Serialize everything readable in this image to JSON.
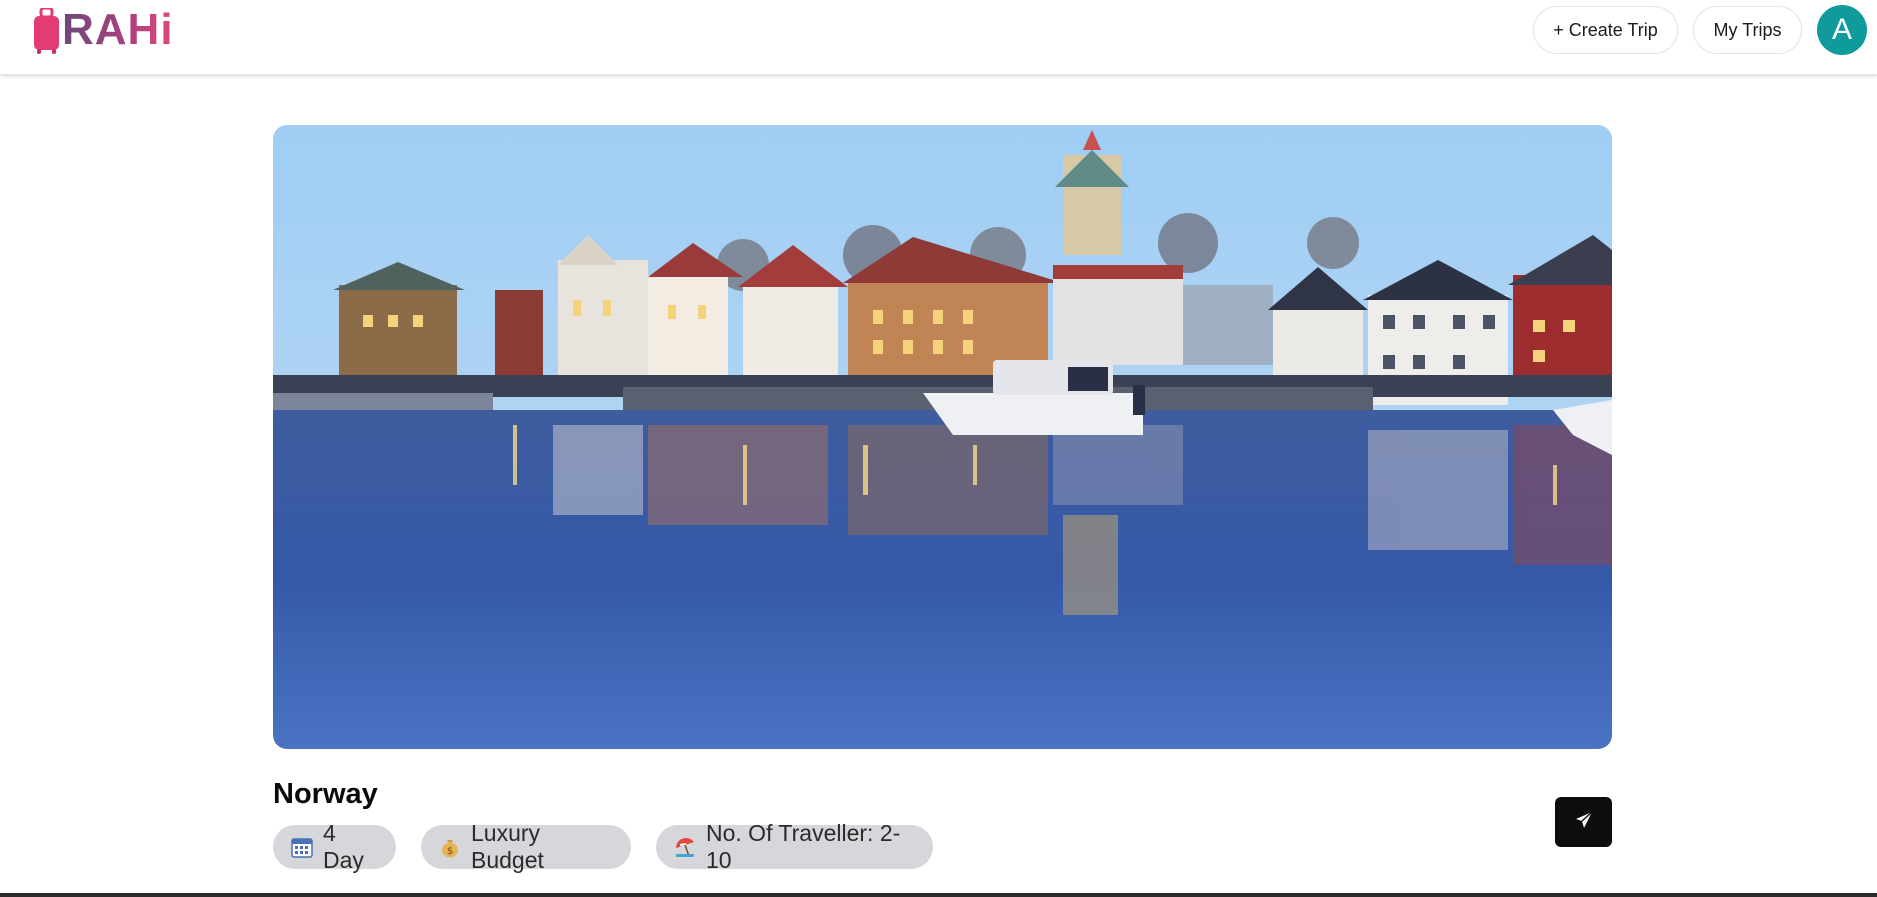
{
  "brand": {
    "name": "RAHi",
    "logo_icon": "suitcase-icon",
    "colors": {
      "primary": "#e0497a",
      "secondary": "#6b4a7a"
    }
  },
  "nav": {
    "create_trip_label": "+ Create Trip",
    "my_trips_label": "My Trips",
    "avatar_initial": "A",
    "avatar_color": "#0f9b9b"
  },
  "trip": {
    "destination": "Norway",
    "hero_image": "harbor-town-at-dusk",
    "chips": [
      {
        "icon": "calendar-icon",
        "label": "4 Day"
      },
      {
        "icon": "money-bag-icon",
        "label": "Luxury Budget"
      },
      {
        "icon": "beach-umbrella-icon",
        "label": "No. Of Traveller: 2-10"
      }
    ],
    "share_icon": "send-icon"
  }
}
